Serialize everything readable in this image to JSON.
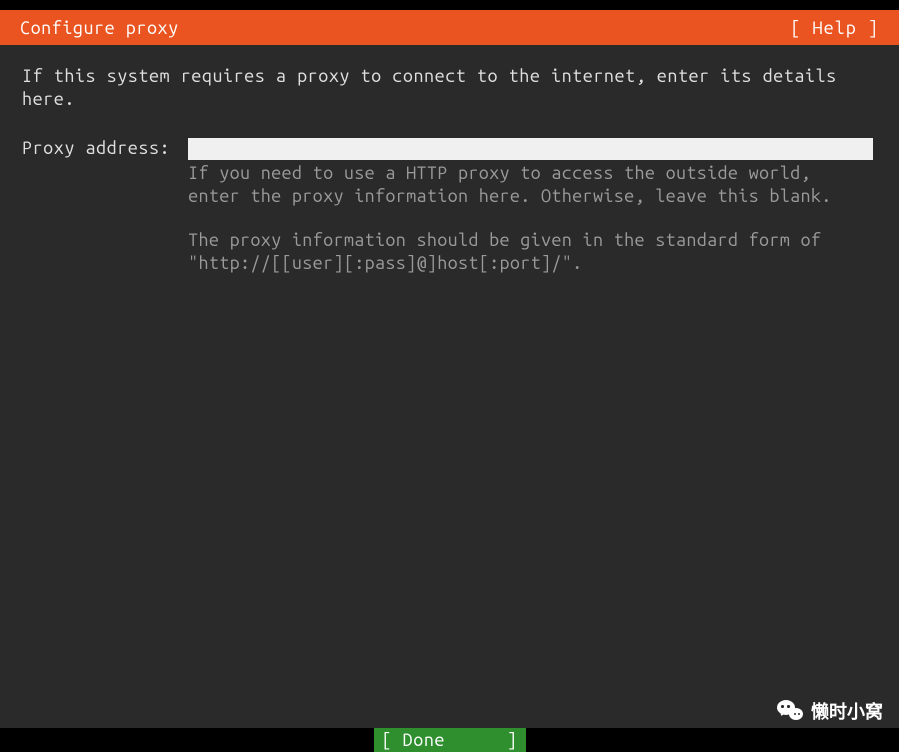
{
  "header": {
    "title": "Configure proxy",
    "help": "[ Help ]"
  },
  "main": {
    "instruction": "If this system requires a proxy to connect to the internet, enter its details here.",
    "field_label": "Proxy address:",
    "field_value": "",
    "help_line1": "If you need to use a HTTP proxy to access the outside world, enter the proxy information here. Otherwise, leave this blank.",
    "help_line2": "The proxy information should be given in the standard form of \"http://[[user][:pass]@]host[:port]/\"."
  },
  "footer": {
    "done_left": "[ Done",
    "done_right": "]"
  },
  "watermark": {
    "text": "懒时小窝"
  }
}
